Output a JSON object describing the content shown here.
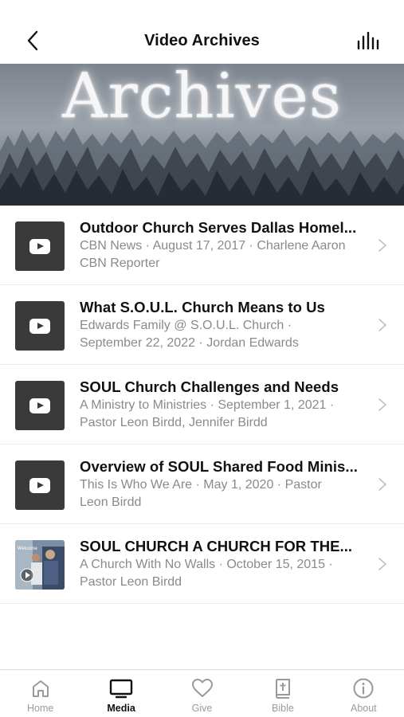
{
  "header": {
    "title": "Video Archives"
  },
  "hero": {
    "title": "Archives"
  },
  "videos": [
    {
      "title": "Outdoor Church Serves Dallas Homel...",
      "line1": "CBN News · August 17, 2017 · Charlene Aaron",
      "line2": "CBN Reporter",
      "thumbnail": "play-icon"
    },
    {
      "title": "What S.O.U.L. Church Means to Us",
      "line1": "Edwards Family @ S.O.U.L. Church ·",
      "line2": "September 22, 2022 · Jordan Edwards",
      "thumbnail": "play-icon"
    },
    {
      "title": "SOUL Church Challenges and Needs",
      "line1": "A Ministry to Ministries · September 1, 2021 ·",
      "line2": "Pastor Leon Birdd, Jennifer Birdd",
      "thumbnail": "play-icon"
    },
    {
      "title": "Overview of SOUL Shared Food Minis...",
      "line1": "This Is Who We Are · May 1, 2020 · Pastor",
      "line2": "Leon Birdd",
      "thumbnail": "play-icon"
    },
    {
      "title": "SOUL CHURCH A CHURCH FOR THE...",
      "line1": "A Church With No Walls · October 15, 2015 ·",
      "line2": "Pastor Leon Birdd",
      "thumbnail": "photo"
    }
  ],
  "tabs": [
    {
      "label": "Home",
      "icon": "home-icon",
      "active": false
    },
    {
      "label": "Media",
      "icon": "tv-icon",
      "active": true
    },
    {
      "label": "Give",
      "icon": "heart-icon",
      "active": false
    },
    {
      "label": "Bible",
      "icon": "bible-icon",
      "active": false
    },
    {
      "label": "About",
      "icon": "info-icon",
      "active": false
    }
  ],
  "colors": {
    "thumb_bg": "#3a3a3a",
    "hero_sky": "#8a929c",
    "hero_trees": "#2a3038",
    "active_tab": "#111111",
    "inactive_tab": "#9a9a9a"
  }
}
